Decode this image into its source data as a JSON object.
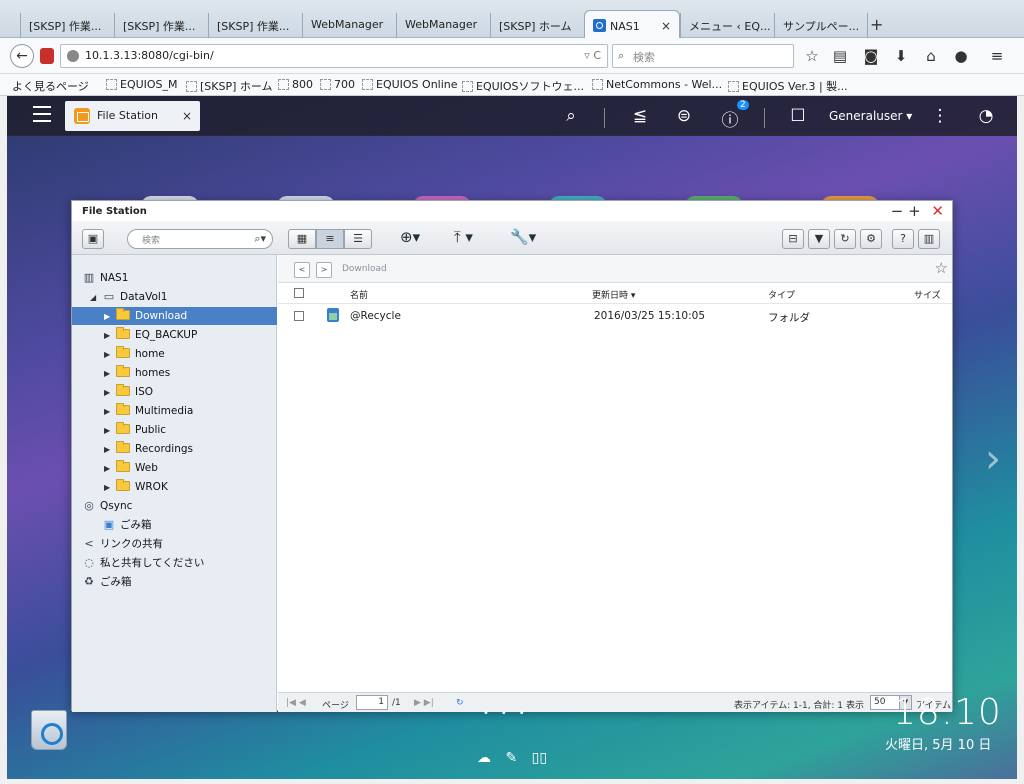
{
  "browser": {
    "tabs": [
      {
        "label": "[SKSP] 作業..."
      },
      {
        "label": "[SKSP] 作業..."
      },
      {
        "label": "[SKSP] 作業..."
      },
      {
        "label": "WebManager"
      },
      {
        "label": "WebManager"
      },
      {
        "label": "[SKSP] ホーム"
      },
      {
        "label": "NAS1",
        "active": true
      },
      {
        "label": "メニュー ‹ EQ..."
      },
      {
        "label": "サンプルペー..."
      }
    ],
    "new_tab": "+",
    "url": "10.1.3.13:8080/cgi-bin/",
    "search_placeholder": "検索",
    "bookmarks": [
      "よく見るページ",
      "EQUIOS_M",
      "[SKSP] ホーム",
      "800",
      "700",
      "EQUIOS Online",
      "EQUIOSソフトウェ...",
      "NetCommons - Wel...",
      "EQUIOS Ver.3 | 製..."
    ]
  },
  "qts": {
    "app_tab": "File Station",
    "user": "Generaluser ▾",
    "notification_count": "2",
    "clock": "18:10",
    "date": "火曜日, 5月 10 日"
  },
  "filestation": {
    "title": "File Station",
    "search_placeholder": "検索",
    "breadcrumb": "Download",
    "tree": [
      {
        "label": "NAS1",
        "level": 0,
        "icon": "server-icon"
      },
      {
        "label": "DataVol1",
        "level": 1,
        "icon": "volume-icon",
        "expanded": true
      },
      {
        "label": "Download",
        "level": 2,
        "icon": "folder-icon",
        "selected": true
      },
      {
        "label": "EQ_BACKUP",
        "level": 2,
        "icon": "folder-icon"
      },
      {
        "label": "home",
        "level": 2,
        "icon": "folder-icon"
      },
      {
        "label": "homes",
        "level": 2,
        "icon": "folder-icon"
      },
      {
        "label": "ISO",
        "level": 2,
        "icon": "folder-icon"
      },
      {
        "label": "Multimedia",
        "level": 2,
        "icon": "folder-icon"
      },
      {
        "label": "Public",
        "level": 2,
        "icon": "folder-icon"
      },
      {
        "label": "Recordings",
        "level": 2,
        "icon": "folder-icon"
      },
      {
        "label": "Web",
        "level": 2,
        "icon": "folder-icon"
      },
      {
        "label": "WROK",
        "level": 2,
        "icon": "folder-icon"
      },
      {
        "label": "Qsync",
        "level": 0,
        "icon": "qsync-icon"
      },
      {
        "label": "ごみ箱",
        "level": 1,
        "icon": "recycle-bin-icon"
      },
      {
        "label": "リンクの共有",
        "level": 0,
        "icon": "share-link-icon"
      },
      {
        "label": "私と共有してください",
        "level": 0,
        "icon": "shared-with-me-icon"
      },
      {
        "label": "ごみ箱",
        "level": 0,
        "icon": "trash-icon"
      }
    ],
    "columns": {
      "name": "名前",
      "modified": "更新日時 ▾",
      "type": "タイプ",
      "size": "サイズ"
    },
    "rows": [
      {
        "name": "@Recycle",
        "modified": "2016/03/25 15:10:05",
        "type": "フォルダ",
        "size": ""
      }
    ],
    "status": {
      "page_label": "ページ",
      "page": "1",
      "page_total": "/1",
      "items": "表示アイテム: 1-1, 合計: 1",
      "show_label": "表示",
      "page_size": "50",
      "items_label": "アイテム"
    }
  }
}
